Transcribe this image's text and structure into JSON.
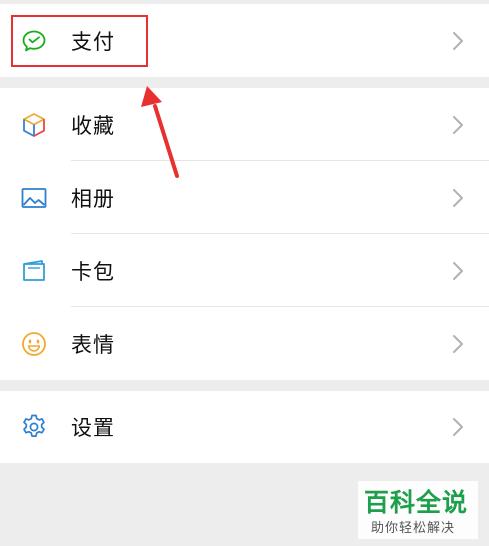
{
  "menu": {
    "items": [
      {
        "label": "支付",
        "icon": "wechat-pay-icon"
      },
      {
        "label": "收藏",
        "icon": "favorites-cube-icon"
      },
      {
        "label": "相册",
        "icon": "album-picture-icon"
      },
      {
        "label": "卡包",
        "icon": "card-wallet-icon"
      },
      {
        "label": "表情",
        "icon": "smiley-sticker-icon"
      },
      {
        "label": "设置",
        "icon": "gear-settings-icon"
      }
    ]
  },
  "annotation": {
    "highlight_color": "#e83030",
    "highlighted_item": "支付"
  },
  "watermark": {
    "title": "百科全说",
    "subtitle": "助你轻松解决",
    "color": "#1d9f4b"
  }
}
